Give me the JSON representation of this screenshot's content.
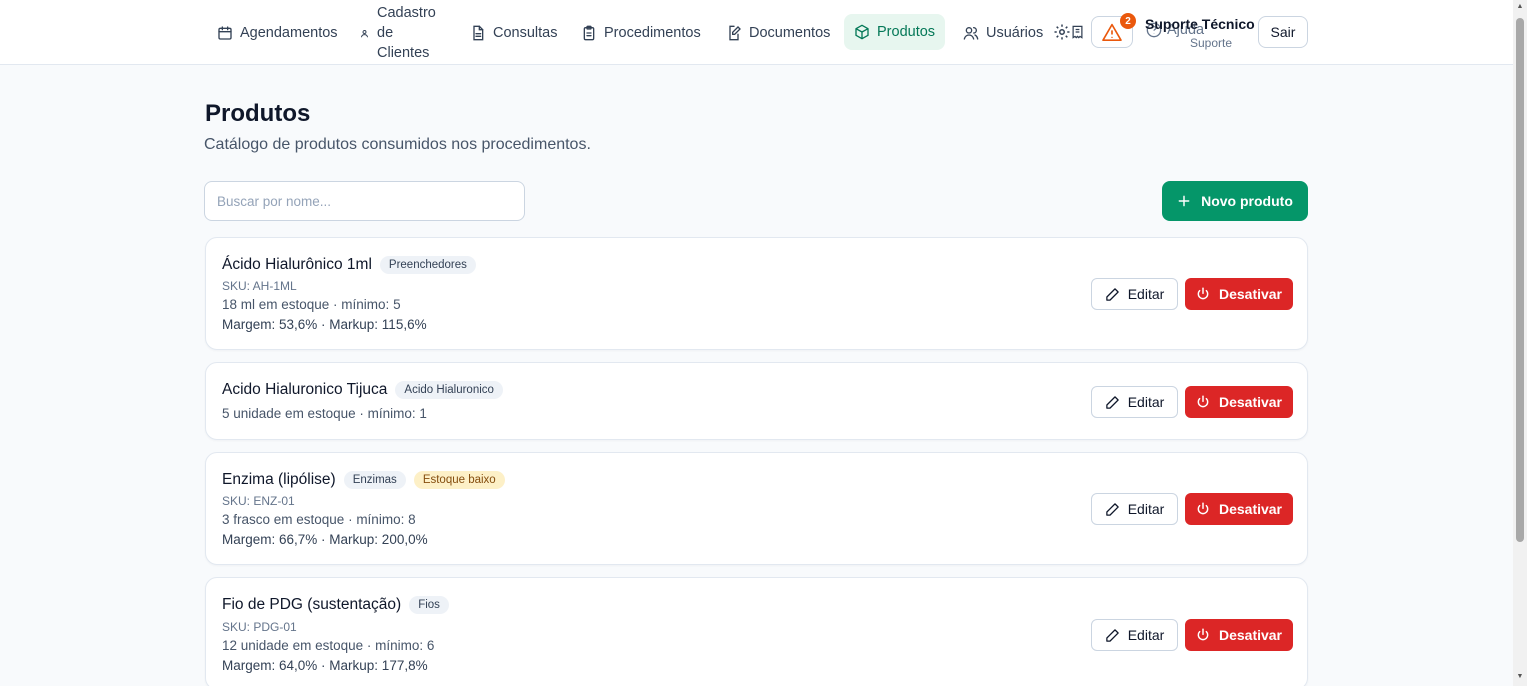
{
  "nav": {
    "agendamentos": "Agendamentos",
    "cadastro": "Cadastro de Clientes",
    "consultas": "Consultas",
    "procedimentos": "Procedimentos",
    "documentos": "Documentos",
    "produtos": "Produtos",
    "usuarios": "Usuários",
    "active": "produtos"
  },
  "header": {
    "alert_count": "2",
    "help": "Ajuda",
    "user_name": "Suporte Técnico",
    "user_role": "Suporte",
    "logout": "Sair",
    "accent_color": "#059669",
    "alert_color": "#ea580c"
  },
  "page": {
    "title": "Produtos",
    "subtitle": "Catálogo de produtos consumidos nos procedimentos.",
    "search_placeholder": "Buscar por nome...",
    "new_button": "Novo produto"
  },
  "actions": {
    "edit": "Editar",
    "deactivate": "Desativar",
    "deactivate_color": "#dc2626"
  },
  "products": [
    {
      "name": "Ácido Hialurônico 1ml",
      "category": "Preenchedores",
      "warning": "",
      "sku": "SKU: AH-1ML",
      "stock": "18 ml em estoque · mínimo: 5",
      "margin": "Margem: 53,6% · Markup: 115,6%"
    },
    {
      "name": "Acido Hialuronico Tijuca",
      "category": "Acido Hialuronico",
      "warning": "",
      "sku": "",
      "stock": "5 unidade em estoque · mínimo: 1",
      "margin": ""
    },
    {
      "name": "Enzima (lipólise)",
      "category": "Enzimas",
      "warning": "Estoque baixo",
      "sku": "SKU: ENZ-01",
      "stock": "3 frasco em estoque · mínimo: 8",
      "margin": "Margem: 66,7% · Markup: 200,0%"
    },
    {
      "name": "Fio de PDG (sustentação)",
      "category": "Fios",
      "warning": "",
      "sku": "SKU: PDG-01",
      "stock": "12 unidade em estoque · mínimo: 6",
      "margin": "Margem: 64,0% · Markup: 177,8%"
    }
  ]
}
